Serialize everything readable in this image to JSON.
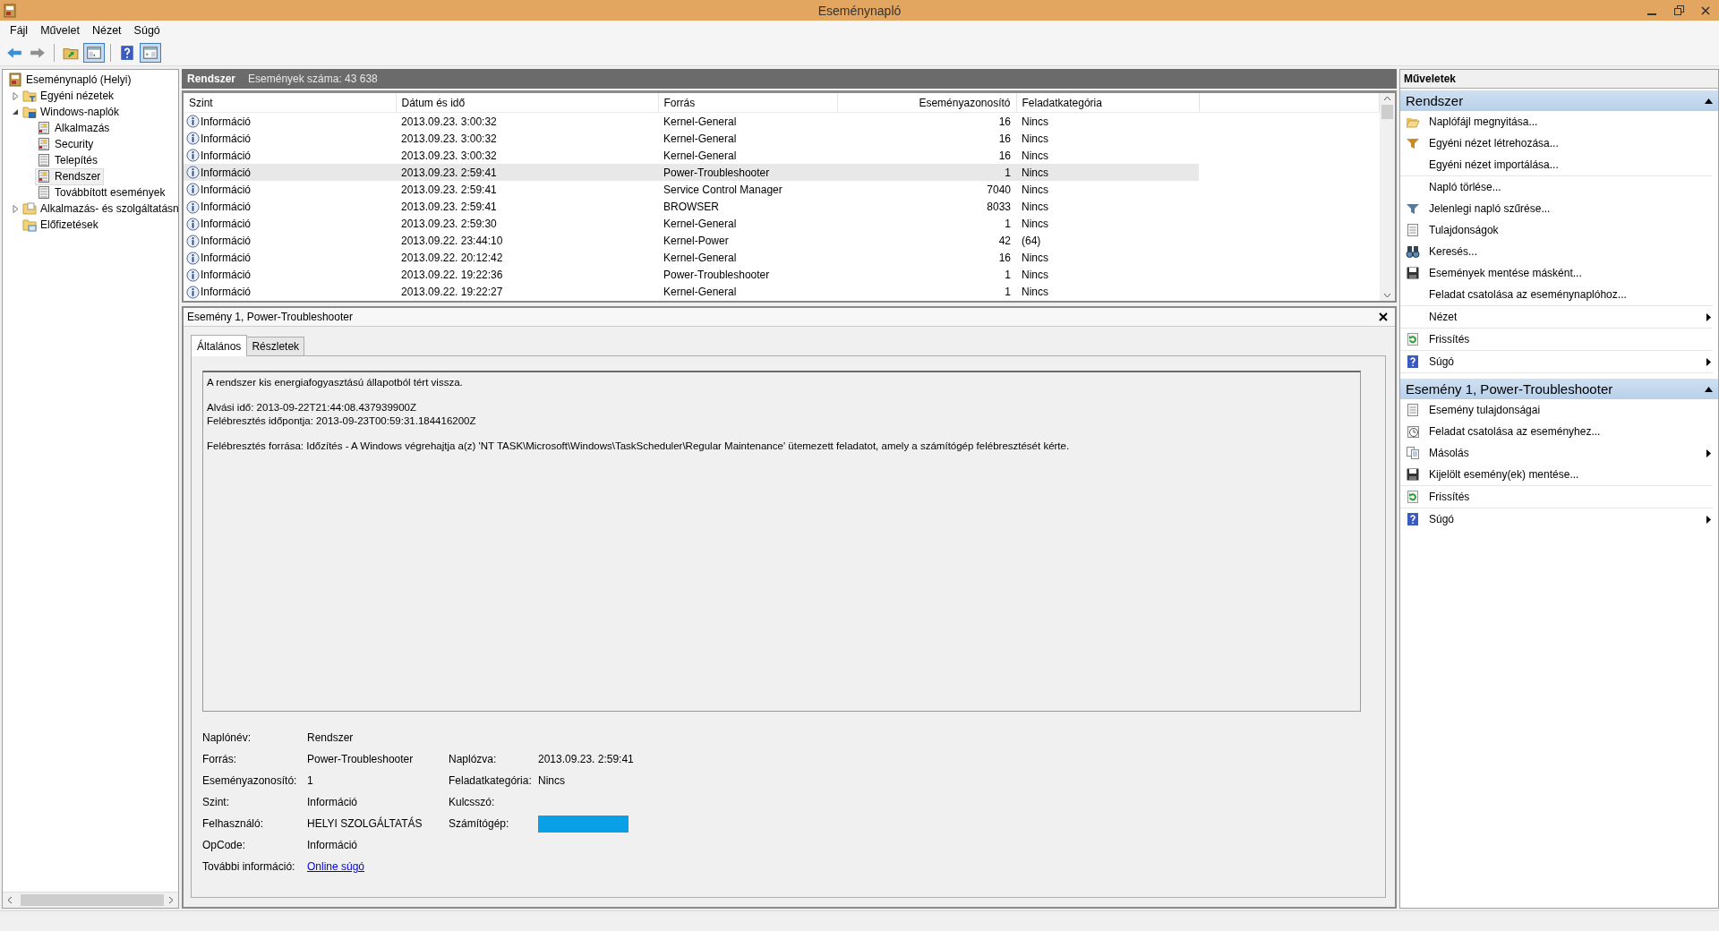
{
  "window": {
    "title": "Eseménynapló"
  },
  "menu": [
    "Fájl",
    "Művelet",
    "Nézet",
    "Súgó"
  ],
  "toolbar": [
    [
      {
        "kind": "back",
        "pressed": false
      },
      {
        "kind": "forward",
        "pressed": false
      }
    ],
    [
      {
        "kind": "folder-up",
        "pressed": false
      },
      {
        "kind": "tree-pane",
        "pressed": true
      }
    ],
    [
      {
        "kind": "help",
        "pressed": false
      },
      {
        "kind": "action-pane",
        "pressed": true
      }
    ]
  ],
  "tree": [
    {
      "label": "Eseménynapló (Helyi)",
      "kind": "app",
      "selected": false,
      "children": [
        {
          "label": "Egyéni nézetek",
          "kind": "folder-filter",
          "expanded": false,
          "selected": false
        },
        {
          "label": "Windows-naplók",
          "kind": "folder-windows",
          "expanded": true,
          "selected": false,
          "children": [
            {
              "label": "Alkalmazás",
              "kind": "log-warn",
              "selected": false
            },
            {
              "label": "Security",
              "kind": "log-warn",
              "selected": false
            },
            {
              "label": "Telepítés",
              "kind": "log-plain",
              "selected": false
            },
            {
              "label": "Rendszer",
              "kind": "log-warn",
              "selected": true
            },
            {
              "label": "Továbbított események",
              "kind": "log-plain",
              "selected": false
            }
          ]
        },
        {
          "label": "Alkalmazás- és szolgáltatásn",
          "kind": "folder-plain",
          "expanded": false,
          "selected": false
        },
        {
          "label": "Előfizetések",
          "kind": "folder-sub",
          "selected": false
        }
      ]
    }
  ],
  "log_header": {
    "name": "Rendszer",
    "count": "Események száma: 43 638"
  },
  "table": {
    "columns": [
      "Szint",
      "Dátum és idő",
      "Forrás",
      "Eseményazonosító",
      "Feladatkategória"
    ],
    "rows": [
      {
        "kind": "info",
        "level": "Információ",
        "date": "2013.09.23. 3:00:32",
        "source": "Kernel-General",
        "event_id": "16",
        "task_category": "Nincs",
        "selected": false
      },
      {
        "kind": "info",
        "level": "Információ",
        "date": "2013.09.23. 3:00:32",
        "source": "Kernel-General",
        "event_id": "16",
        "task_category": "Nincs",
        "selected": false
      },
      {
        "kind": "info",
        "level": "Információ",
        "date": "2013.09.23. 3:00:32",
        "source": "Kernel-General",
        "event_id": "16",
        "task_category": "Nincs",
        "selected": false
      },
      {
        "kind": "info",
        "level": "Információ",
        "date": "2013.09.23. 2:59:41",
        "source": "Power-Troubleshooter",
        "event_id": "1",
        "task_category": "Nincs",
        "selected": true
      },
      {
        "kind": "info",
        "level": "Információ",
        "date": "2013.09.23. 2:59:41",
        "source": "Service Control Manager",
        "event_id": "7040",
        "task_category": "Nincs",
        "selected": false
      },
      {
        "kind": "info",
        "level": "Információ",
        "date": "2013.09.23. 2:59:41",
        "source": "BROWSER",
        "event_id": "8033",
        "task_category": "Nincs",
        "selected": false
      },
      {
        "kind": "info",
        "level": "Információ",
        "date": "2013.09.23. 2:59:30",
        "source": "Kernel-General",
        "event_id": "1",
        "task_category": "Nincs",
        "selected": false
      },
      {
        "kind": "info",
        "level": "Információ",
        "date": "2013.09.22. 23:44:10",
        "source": "Kernel-Power",
        "event_id": "42",
        "task_category": "(64)",
        "selected": false
      },
      {
        "kind": "info",
        "level": "Információ",
        "date": "2013.09.22. 20:12:42",
        "source": "Kernel-General",
        "event_id": "16",
        "task_category": "Nincs",
        "selected": false
      },
      {
        "kind": "info",
        "level": "Információ",
        "date": "2013.09.22. 19:22:36",
        "source": "Power-Troubleshooter",
        "event_id": "1",
        "task_category": "Nincs",
        "selected": false
      },
      {
        "kind": "info",
        "level": "Információ",
        "date": "2013.09.22. 19:22:27",
        "source": "Kernel-General",
        "event_id": "1",
        "task_category": "Nincs",
        "selected": false
      }
    ]
  },
  "details": {
    "title": "Esemény 1, Power-Troubleshooter",
    "tabs": [
      {
        "label": "Általános",
        "selected": true
      },
      {
        "label": "Részletek",
        "selected": false
      }
    ],
    "message": [
      [
        "A rendszer kis energiafogyasztású állapotból tért vissza."
      ],
      [
        "Alvási idő: 2013-09-22T21:44:08.437939900Z",
        "Felébresztés időpontja: 2013-09-23T00:59:31.184416200Z"
      ],
      [
        "Felébresztés forrása: Időzítés - A Windows végrehajtja a(z) 'NT TASK\\Microsoft\\Windows\\TaskScheduler\\Regular Maintenance' ütemezett feladatot, amely a számítógép felébresztését kérte."
      ]
    ],
    "fields": [
      [
        {
          "label": "Naplónév:",
          "kind": "text",
          "value": "Rendszer"
        }
      ],
      [
        {
          "label": "Forrás:",
          "kind": "text",
          "value": "Power-Troubleshooter"
        },
        {
          "label": "Naplózva:",
          "kind": "text",
          "value": "2013.09.23. 2:59:41"
        }
      ],
      [
        {
          "label": "Eseményazonosító:",
          "kind": "text",
          "value": "1"
        },
        {
          "label": "Feladatkategória:",
          "kind": "text",
          "value": "Nincs"
        }
      ],
      [
        {
          "label": "Szint:",
          "kind": "text",
          "value": "Információ"
        },
        {
          "label": "Kulcsszó:",
          "kind": "empty"
        }
      ],
      [
        {
          "label": "Felhasználó:",
          "kind": "text",
          "value": "HELYI SZOLGÁLTATÁS"
        },
        {
          "label": "Számítógép:",
          "kind": "redacted"
        }
      ],
      [
        {
          "label": "OpCode:",
          "kind": "text",
          "value": "Információ"
        }
      ],
      [
        {
          "label": "További információ:",
          "kind": "link",
          "value": "Online súgó"
        }
      ]
    ]
  },
  "actions": {
    "title": "Műveletek",
    "sections": [
      {
        "title": "Rendszer",
        "expanded": true,
        "groups": [
          [
            {
              "label": "Naplófájl megnyitása...",
              "kind": "open-folder",
              "submenu": false
            },
            {
              "label": "Egyéni nézet létrehozása...",
              "kind": "filter-star",
              "submenu": false
            },
            {
              "label": "Egyéni nézet importálása...",
              "kind": "plain",
              "submenu": false
            }
          ],
          [
            {
              "label": "Napló törlése...",
              "kind": "plain",
              "submenu": false
            },
            {
              "label": "Jelenlegi napló szűrése...",
              "kind": "filter",
              "submenu": false
            },
            {
              "label": "Tulajdonságok",
              "kind": "properties",
              "submenu": false
            },
            {
              "label": "Keresés...",
              "kind": "binoculars",
              "submenu": false
            },
            {
              "label": "Események mentése másként...",
              "kind": "save",
              "submenu": false
            },
            {
              "label": "Feladat csatolása az eseménynaplóhoz...",
              "kind": "plain",
              "submenu": false
            }
          ],
          [
            {
              "label": "Nézet",
              "kind": "plain",
              "submenu": true
            }
          ],
          [
            {
              "label": "Frissítés",
              "kind": "refresh",
              "submenu": false
            }
          ],
          [
            {
              "label": "Súgó",
              "kind": "help",
              "submenu": true
            }
          ]
        ]
      },
      {
        "title": "Esemény 1, Power-Troubleshooter",
        "expanded": true,
        "groups": [
          [
            {
              "label": "Esemény tulajdonságai",
              "kind": "properties",
              "submenu": false
            },
            {
              "label": "Feladat csatolása az eseményhez...",
              "kind": "task-clock",
              "submenu": false
            },
            {
              "label": "Másolás",
              "kind": "copy",
              "submenu": true
            },
            {
              "label": "Kijelölt esemény(ek) mentése...",
              "kind": "save",
              "submenu": false
            }
          ],
          [
            {
              "label": "Frissítés",
              "kind": "refresh",
              "submenu": false
            }
          ],
          [
            {
              "label": "Súgó",
              "kind": "help",
              "submenu": true
            }
          ]
        ]
      }
    ]
  }
}
